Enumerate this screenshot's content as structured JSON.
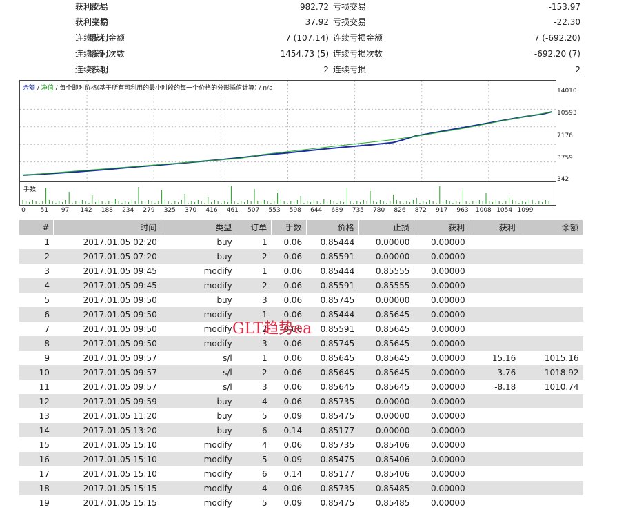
{
  "stats": [
    {
      "prefix": "最大:",
      "name1": "获利交易",
      "value1": "982.72",
      "name2": "亏损交易",
      "value2": "-153.97"
    },
    {
      "prefix": "平均",
      "name1": "获利交易",
      "value1": "37.92",
      "name2": "亏损交易",
      "value2": "-22.30"
    },
    {
      "prefix": "最大:",
      "name1": "连续获利金额",
      "value1": "7 (107.14)",
      "name2": "连续亏损金额",
      "value2": "7 (-692.20)"
    },
    {
      "prefix": "最多:",
      "name1": "连续获利次数",
      "value1": "1454.73 (5)",
      "name2": "连续亏损次数",
      "value2": "-692.20 (7)"
    },
    {
      "prefix": "平均:",
      "name1": "连续获利",
      "value1": "2",
      "name2": "连续亏损",
      "value2": "2"
    }
  ],
  "chart": {
    "legend_balance": "余额",
    "legend_sep1": " / ",
    "legend_equity": "净值",
    "legend_rest": " / 每个即时价格(基于所有可利用的最小时段的每一个价格的分形插值计算) / n/a",
    "lot_label": "手数",
    "y_ticks": [
      "14010",
      "10593",
      "7176",
      "3759",
      "342"
    ],
    "x_ticks": [
      "0",
      "51",
      "97",
      "142",
      "188",
      "234",
      "279",
      "325",
      "370",
      "416",
      "461",
      "507",
      "553",
      "598",
      "644",
      "689",
      "735",
      "780",
      "826",
      "872",
      "917",
      "963",
      "1008",
      "1054",
      "1099"
    ],
    "colors": {
      "balance": "#1a2fa0",
      "equity": "#22b022",
      "lots": "#22a022"
    }
  },
  "chart_data": {
    "type": "line",
    "y_range": [
      342,
      14010
    ],
    "x_range": [
      0,
      1115
    ],
    "series": [
      {
        "values": [
          [
            0,
            1000
          ],
          [
            60,
            1250
          ],
          [
            120,
            1550
          ],
          [
            180,
            1900
          ],
          [
            240,
            2300
          ],
          [
            300,
            2650
          ],
          [
            360,
            3050
          ],
          [
            420,
            3450
          ],
          [
            461,
            3750
          ],
          [
            507,
            4150
          ],
          [
            553,
            4450
          ],
          [
            598,
            4800
          ],
          [
            644,
            5150
          ],
          [
            689,
            5450
          ],
          [
            735,
            5750
          ],
          [
            780,
            6100
          ],
          [
            800,
            6500
          ],
          [
            826,
            7100
          ],
          [
            872,
            7700
          ],
          [
            917,
            8300
          ],
          [
            963,
            8900
          ],
          [
            1008,
            9500
          ],
          [
            1054,
            10100
          ],
          [
            1099,
            10600
          ],
          [
            1115,
            10900
          ]
        ]
      },
      {
        "values": [
          [
            0,
            1000
          ],
          [
            461,
            3650
          ],
          [
            507,
            4250
          ],
          [
            780,
            6550
          ],
          [
            826,
            7050
          ],
          [
            917,
            8150
          ],
          [
            1008,
            9450
          ],
          [
            1115,
            10900
          ]
        ]
      }
    ]
  },
  "table": {
    "headers": [
      "#",
      "时间",
      "类型",
      "订单",
      "手数",
      "价格",
      "止损",
      "获利",
      "获利",
      "余额"
    ],
    "rows": [
      [
        "1",
        "2017.01.05 02:20",
        "buy",
        "1",
        "0.06",
        "0.85444",
        "0.00000",
        "0.00000",
        "",
        ""
      ],
      [
        "2",
        "2017.01.05 07:20",
        "buy",
        "2",
        "0.06",
        "0.85591",
        "0.00000",
        "0.00000",
        "",
        ""
      ],
      [
        "3",
        "2017.01.05 09:45",
        "modify",
        "1",
        "0.06",
        "0.85444",
        "0.85555",
        "0.00000",
        "",
        ""
      ],
      [
        "4",
        "2017.01.05 09:45",
        "modify",
        "2",
        "0.06",
        "0.85591",
        "0.85555",
        "0.00000",
        "",
        ""
      ],
      [
        "5",
        "2017.01.05 09:50",
        "buy",
        "3",
        "0.06",
        "0.85745",
        "0.00000",
        "0.00000",
        "",
        ""
      ],
      [
        "6",
        "2017.01.05 09:50",
        "modify",
        "1",
        "0.06",
        "0.85444",
        "0.85645",
        "0.00000",
        "",
        ""
      ],
      [
        "7",
        "2017.01.05 09:50",
        "modify",
        "2",
        "0.06",
        "0.85591",
        "0.85645",
        "0.00000",
        "",
        ""
      ],
      [
        "8",
        "2017.01.05 09:50",
        "modify",
        "3",
        "0.06",
        "0.85745",
        "0.85645",
        "0.00000",
        "",
        ""
      ],
      [
        "9",
        "2017.01.05 09:57",
        "s/l",
        "1",
        "0.06",
        "0.85645",
        "0.85645",
        "0.00000",
        "15.16",
        "1015.16"
      ],
      [
        "10",
        "2017.01.05 09:57",
        "s/l",
        "2",
        "0.06",
        "0.85645",
        "0.85645",
        "0.00000",
        "3.76",
        "1018.92"
      ],
      [
        "11",
        "2017.01.05 09:57",
        "s/l",
        "3",
        "0.06",
        "0.85645",
        "0.85645",
        "0.00000",
        "-8.18",
        "1010.74"
      ],
      [
        "12",
        "2017.01.05 09:59",
        "buy",
        "4",
        "0.06",
        "0.85735",
        "0.00000",
        "0.00000",
        "",
        ""
      ],
      [
        "13",
        "2017.01.05 11:20",
        "buy",
        "5",
        "0.09",
        "0.85475",
        "0.00000",
        "0.00000",
        "",
        ""
      ],
      [
        "14",
        "2017.01.05 13:20",
        "buy",
        "6",
        "0.14",
        "0.85177",
        "0.00000",
        "0.00000",
        "",
        ""
      ],
      [
        "15",
        "2017.01.05 15:10",
        "modify",
        "4",
        "0.06",
        "0.85735",
        "0.85406",
        "0.00000",
        "",
        ""
      ],
      [
        "16",
        "2017.01.05 15:10",
        "modify",
        "5",
        "0.09",
        "0.85475",
        "0.85406",
        "0.00000",
        "",
        ""
      ],
      [
        "17",
        "2017.01.05 15:10",
        "modify",
        "6",
        "0.14",
        "0.85177",
        "0.85406",
        "0.00000",
        "",
        ""
      ],
      [
        "18",
        "2017.01.05 15:15",
        "modify",
        "4",
        "0.06",
        "0.85735",
        "0.85485",
        "0.00000",
        "",
        ""
      ],
      [
        "19",
        "2017.01.05 15:15",
        "modify",
        "5",
        "0.09",
        "0.85475",
        "0.85485",
        "0.00000",
        "",
        ""
      ]
    ]
  },
  "watermark": "GLT趋势ea"
}
